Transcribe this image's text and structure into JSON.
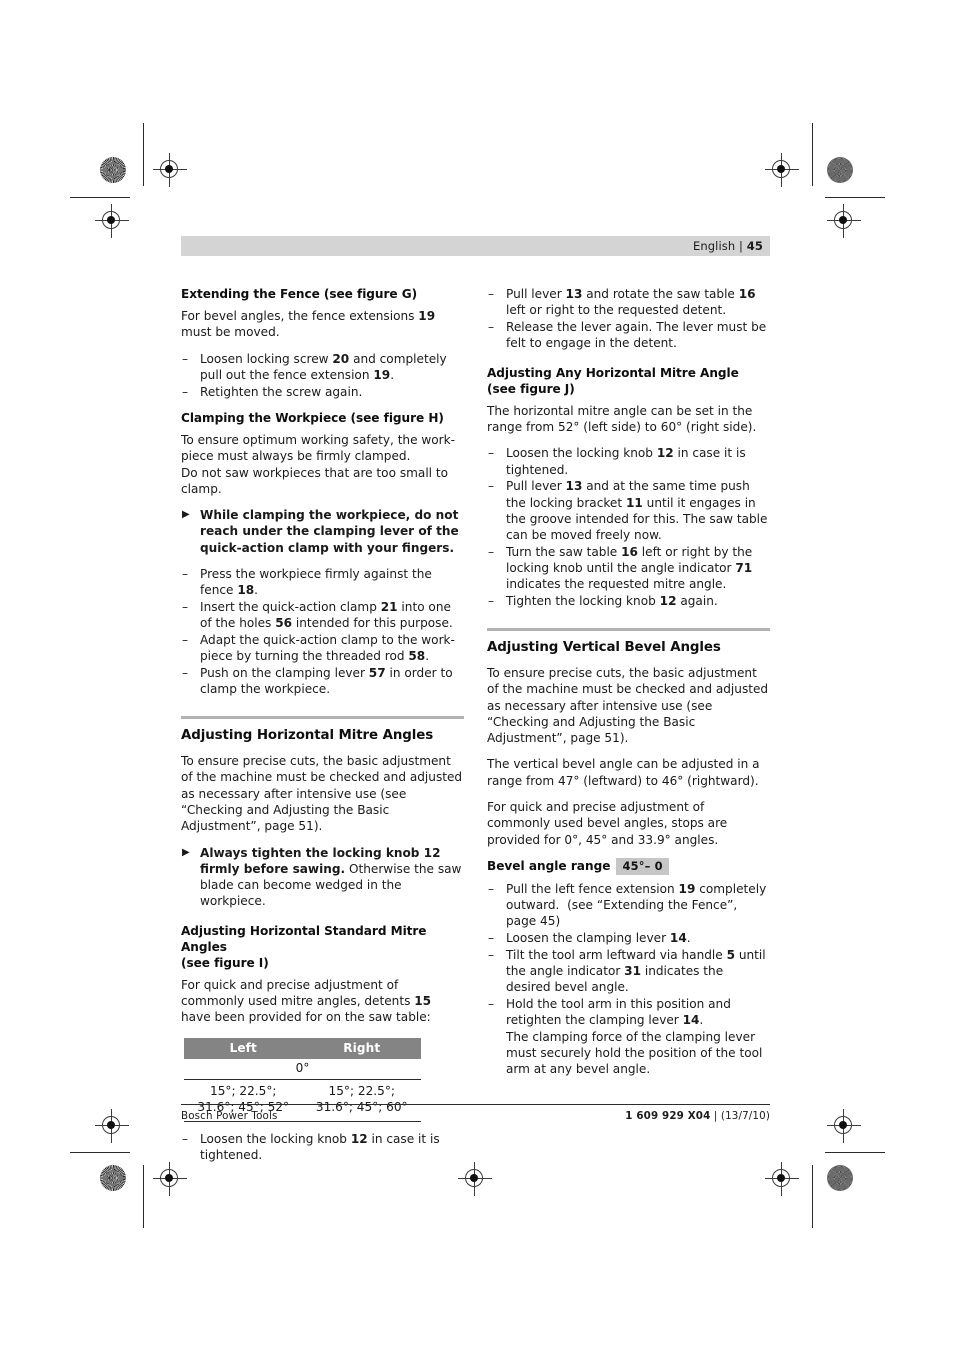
{
  "header": {
    "language": "English",
    "separator": "|",
    "page_number": "45"
  },
  "left_column": {
    "sections": [
      {
        "heading": "Extending the Fence (see figure G)",
        "paragraph": "For bevel angles, the fence extensions 19 must be moved.",
        "bullets": [
          "Loosen locking screw 20 and completely pull out the fence extension 19.",
          "Retighten the screw again."
        ]
      },
      {
        "heading": "Clamping the Workpiece (see figure H)",
        "paragraph_1": "To ensure optimum working safety, the work-piece must always be firmly clamped.",
        "paragraph_2": "Do not saw workpieces that are too small to clamp.",
        "warning": "While clamping the workpiece, do not reach under the clamping lever of the quick-action clamp with your fingers.",
        "bullets": [
          "Press the workpiece firmly against the fence 18.",
          "Insert the quick-action clamp 21 into one of the holes 56 intended for this purpose.",
          "Adapt the quick-action clamp to the work-piece by turning the threaded rod 58.",
          "Push on the clamping lever 57 in order to clamp the workpiece."
        ]
      }
    ],
    "major_section": {
      "heading": "Adjusting Horizontal Mitre Angles",
      "paragraph": "To ensure precise cuts, the basic adjustment of the machine must be checked and adjusted as necessary after intensive use (see “Checking and Adjusting the Basic Adjustment”, page 51).",
      "warning_bold": "Always tighten the locking knob 12 firmly before sawing.",
      "warning_rest": " Otherwise the saw blade can become wedged in the workpiece."
    },
    "subsection": {
      "heading_line_1": "Adjusting Horizontal Standard Mitre Angles",
      "heading_line_2": "(see figure I)",
      "paragraph": "For quick and precise adjustment of commonly used mitre angles, detents 15 have been provided for on the saw table:",
      "trailing_bullet": "Loosen the locking knob 12 in case it is tightened."
    }
  },
  "mitre_table": {
    "columns": [
      "Left",
      "Right"
    ],
    "zero_row": "0°",
    "rows": [
      {
        "left_line_1": "15°; 22.5°;",
        "left_line_2": "31.6°; 45°; 52°",
        "right_line_1": "15°; 22.5°;",
        "right_line_2": "31.6°; 45°; 60°"
      }
    ],
    "header_bg": "#848484",
    "header_fg": "#ffffff"
  },
  "right_column": {
    "continued_bullets": [
      "Pull lever 13 and rotate the saw table 16 left or right to the requested detent.",
      "Release the lever again. The lever must be felt to engage in the detent."
    ],
    "subsection_any": {
      "heading_line_1": "Adjusting Any Horizontal Mitre Angle",
      "heading_line_2": "(see figure J)",
      "paragraph": "The horizontal mitre angle can be set in the range from 52° (left side) to 60° (right side).",
      "bullets": [
        "Loosen the locking knob 12 in case it is tightened.",
        "Pull lever 13 and at the same time push the locking bracket 11 until it engages in the groove intended for this. The saw table can be moved freely now.",
        "Turn the saw table 16 left or right by the locking knob until the angle indicator 71 indicates the requested mitre angle.",
        "Tighten the locking knob 12 again."
      ]
    },
    "major_section": {
      "heading": "Adjusting Vertical Bevel Angles",
      "paragraph_1": "To ensure precise cuts, the basic adjustment of the machine must be checked and adjusted as necessary after intensive use (see “Checking and Adjusting the Basic Adjustment”, page 51).",
      "paragraph_2": "The vertical bevel angle can be adjusted in a range from 47° (leftward) to 46° (rightward).",
      "paragraph_3": "For quick and precise adjustment of commonly used bevel angles, stops are provided for 0°, 45° and 33.9° angles."
    },
    "bevel_range": {
      "label": "Bevel angle range",
      "badge": "45°– 0",
      "badge_bg": "#c6c6c6"
    },
    "bevel_bullets": [
      {
        "text": "Pull the left fence extension 19 completely outward.  (see “Extending the Fence”, page 45)"
      },
      {
        "text": "Loosen the clamping lever 14."
      },
      {
        "text": "Tilt the tool arm leftward via handle 5 until the angle indicator 31 indicates the desired bevel angle."
      },
      {
        "text": "Hold the tool arm in this position and retighten the clamping lever 14.",
        "continuation": "The clamping force of the clamping lever must securely hold the position of the tool arm at any bevel angle."
      }
    ]
  },
  "footer": {
    "left": "Bosch Power Tools",
    "right_code": "1 609 929 X04",
    "right_separator": "|",
    "right_date": "(13/7/10)"
  }
}
